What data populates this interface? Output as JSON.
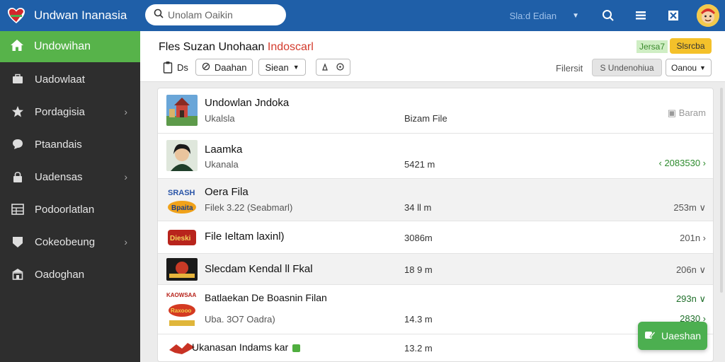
{
  "app": {
    "title": "Undwan Inanasia",
    "search_placeholder": "Unolam Oaikin",
    "top_select_label": "Sla:d Edian",
    "colors": {
      "topbar": "#1f5fa8",
      "sidebar": "#2e2e2e",
      "active": "#57b34a",
      "accent_red": "#d33a2c",
      "yellow": "#f4c12a"
    }
  },
  "topbar_icons": [
    "search-icon",
    "list-icon",
    "grid-icon",
    "avatar"
  ],
  "sidebar": {
    "active": {
      "label": "Undowihan",
      "icon": "home-icon"
    },
    "items": [
      {
        "label": "Uadowlaat",
        "icon": "briefcase-icon",
        "arrow": ""
      },
      {
        "label": "Pordagisia",
        "icon": "star-icon",
        "arrow": "›"
      },
      {
        "label": "Ptaandais",
        "icon": "chat-icon",
        "arrow": ""
      },
      {
        "label": "Uadensas",
        "icon": "lock-icon",
        "arrow": "›"
      },
      {
        "label": "Podoorlatlan",
        "icon": "table-icon",
        "arrow": ""
      },
      {
        "label": "Cokeobeung",
        "icon": "tag-icon",
        "arrow": "›"
      },
      {
        "label": "Oadoghan",
        "icon": "building-icon",
        "arrow": ""
      }
    ]
  },
  "header": {
    "title_main": "Fles Suzan Unohaan",
    "title_accent": "Indoscarl",
    "badge": "Jersa7",
    "yellow_button": "Slsrcba",
    "tool_text": "Ds",
    "btn_oadmon": "Daahan",
    "btn_sean": "Siean",
    "filter_label": "Filersit",
    "filter_button": "S Undenohiua",
    "sort_button": "Oanou"
  },
  "rows": [
    {
      "title": "Undowlan Jndoka",
      "subtitle": "Ukalsla",
      "size": "Bizam File",
      "right": "Baram",
      "right_icon": "lock",
      "thumb": "castle"
    },
    {
      "title": "Laamka",
      "subtitle": "Ukanala",
      "size": "5421 m",
      "right": "‹ 2083530 ›",
      "right_icon": "",
      "thumb": "portrait"
    },
    {
      "title": "Oera Fila",
      "subtitle": "Filek 3.22 (Seabmarl)",
      "size": "34 ll m",
      "right": "253m ∨",
      "right_icon": "",
      "thumb": "logo-brand"
    },
    {
      "title": "File Ieltam laxinl)",
      "subtitle": "",
      "size": "3086m",
      "right": "201n ›",
      "right_icon": "",
      "thumb": "logo-red"
    },
    {
      "title": "Slecdam Kendal ll Fkal",
      "subtitle": "",
      "size": "18 9 m",
      "right": "206n ∨",
      "right_icon": "",
      "thumb": "logo-dark"
    },
    {
      "title": "Batlaekan De Boasnin Filan",
      "subtitle": "Uba. 3O7 Oadra)",
      "size": "14.3 m",
      "right": "293n ∨",
      "right2": "2830 ›",
      "right_icon": "",
      "thumb": "logo-multi"
    },
    {
      "title": "Ukanasan Indams kar",
      "subtitle": "",
      "size": "13.2 m",
      "right": "",
      "right_icon": "",
      "thumb": "logo-small"
    }
  ],
  "fab": {
    "label": "Uaeshan",
    "icon": "edit-icon"
  }
}
